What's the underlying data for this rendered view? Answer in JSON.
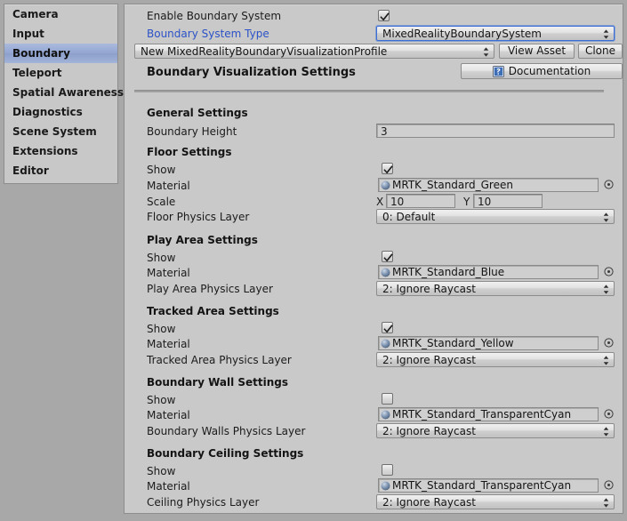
{
  "sidebar": {
    "items": [
      {
        "label": "Camera",
        "selected": false
      },
      {
        "label": "Input",
        "selected": false
      },
      {
        "label": "Boundary",
        "selected": true
      },
      {
        "label": "Teleport",
        "selected": false
      },
      {
        "label": "Spatial Awareness",
        "selected": false
      },
      {
        "label": "Diagnostics",
        "selected": false
      },
      {
        "label": "Scene System",
        "selected": false
      },
      {
        "label": "Extensions",
        "selected": false
      },
      {
        "label": "Editor",
        "selected": false
      }
    ]
  },
  "panel": {
    "enable_label": "Enable Boundary System",
    "enable_checked": true,
    "system_type_label": "Boundary System Type",
    "system_type_value": "MixedRealityBoundarySystem",
    "profile_value": "New MixedRealityBoundaryVisualizationProfile",
    "view_asset_label": "View Asset",
    "clone_label": "Clone",
    "section_title": "Boundary Visualization Settings",
    "documentation_label": "Documentation",
    "general": {
      "header": "General Settings",
      "boundary_height_label": "Boundary Height",
      "boundary_height_value": "3"
    },
    "floor": {
      "header": "Floor Settings",
      "show_label": "Show",
      "show_checked": true,
      "material_label": "Material",
      "material_value": "MRTK_Standard_Green",
      "scale_label": "Scale",
      "scale_x_axis": "X",
      "scale_x_value": "10",
      "scale_y_axis": "Y",
      "scale_y_value": "10",
      "layer_label": "Floor Physics Layer",
      "layer_value": "0: Default"
    },
    "play_area": {
      "header": "Play Area Settings",
      "show_label": "Show",
      "show_checked": true,
      "material_label": "Material",
      "material_value": "MRTK_Standard_Blue",
      "layer_label": "Play Area Physics Layer",
      "layer_value": "2: Ignore Raycast"
    },
    "tracked_area": {
      "header": "Tracked Area Settings",
      "show_label": "Show",
      "show_checked": true,
      "material_label": "Material",
      "material_value": "MRTK_Standard_Yellow",
      "layer_label": "Tracked Area Physics Layer",
      "layer_value": "2: Ignore Raycast"
    },
    "boundary_wall": {
      "header": "Boundary Wall Settings",
      "show_label": "Show",
      "show_checked": false,
      "material_label": "Material",
      "material_value": "MRTK_Standard_TransparentCyan",
      "layer_label": "Boundary Walls Physics Layer",
      "layer_value": "2: Ignore Raycast"
    },
    "boundary_ceiling": {
      "header": "Boundary Ceiling Settings",
      "show_label": "Show",
      "show_checked": false,
      "material_label": "Material",
      "material_value": "MRTK_Standard_TransparentCyan",
      "layer_label": "Ceiling Physics Layer",
      "layer_value": "2: Ignore Raycast"
    }
  },
  "icons": {
    "sphere": "sphere-icon",
    "target_picker": "target-picker-icon",
    "dropdown_arrows": "updown-arrows-icon",
    "documentation": "book-help-icon",
    "checkmark": "checkmark-icon"
  },
  "colors": {
    "accent_link": "#2b52c8",
    "selection": "#93a6d1",
    "panel_bg": "#c9c9c9",
    "window_bg": "#a8a8a8"
  }
}
